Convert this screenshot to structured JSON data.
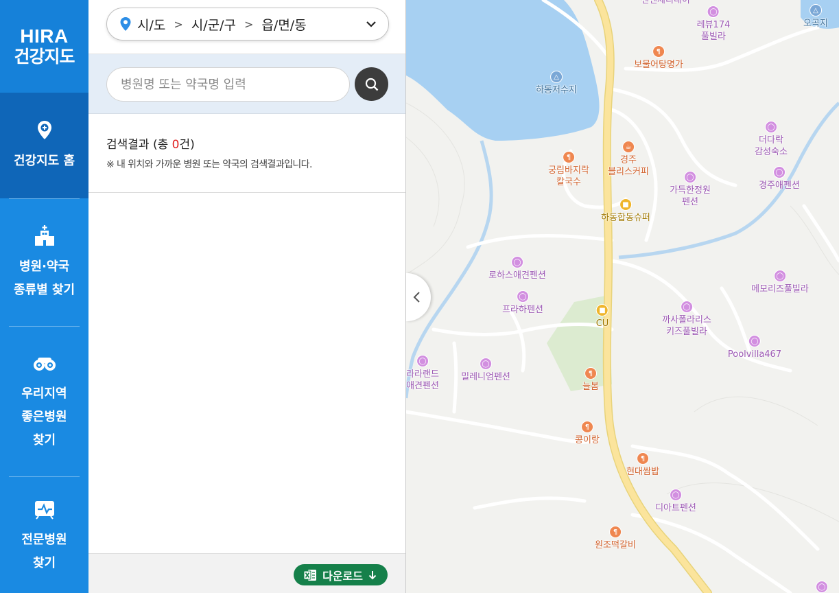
{
  "nav": {
    "logo_line1": "HIRA",
    "logo_line2": "건강지도",
    "items": [
      {
        "label": "건강지도 홈",
        "icon": "map-pin-plus-icon",
        "active": true
      },
      {
        "label_line1": "병원·약국",
        "label_line2": "종류별 찾기",
        "icon": "hospital-building-icon"
      },
      {
        "label_line1": "우리지역",
        "label_line2": "좋은병원",
        "label_line3": "찾기",
        "icon": "binoculars-icon"
      },
      {
        "label_line1": "전문병원",
        "label_line2": "찾기",
        "icon": "medical-monitor-icon"
      }
    ]
  },
  "region": {
    "level1": "시/도",
    "level2": "시/군/구",
    "level3": "읍/면/동"
  },
  "search": {
    "placeholder": "병원명 또는 약국명 입력",
    "value": ""
  },
  "results": {
    "title_prefix": "검색결과 (총 ",
    "count": "0",
    "title_suffix": "건)",
    "note": "※ 내 위치와 가까운 병원 또는 약국의 검색결과입니다."
  },
  "footer": {
    "download_label": "다운로드"
  },
  "map": {
    "pois": [
      {
        "label": "센넨체리네이",
        "type": "stay"
      },
      {
        "label": "레뷰174\n풀빌라",
        "type": "stay"
      },
      {
        "label": "오곡지",
        "type": "water"
      },
      {
        "label": "보물어탕명가",
        "type": "food"
      },
      {
        "label": "하동저수지",
        "type": "water"
      },
      {
        "label": "경주\n블리스커피",
        "type": "food"
      },
      {
        "label": "더다락\n감성숙소",
        "type": "stay"
      },
      {
        "label": "궁림바지락\n칼국수",
        "type": "food"
      },
      {
        "label": "가득한정원\n펜션",
        "type": "stay"
      },
      {
        "label": "경주애펜션",
        "type": "stay"
      },
      {
        "label": "하동합동슈퍼",
        "type": "store"
      },
      {
        "label": "로하스애견펜션",
        "type": "stay"
      },
      {
        "label": "메모리즈풀빌라",
        "type": "stay"
      },
      {
        "label": "프라하펜션",
        "type": "stay"
      },
      {
        "label": "CU",
        "type": "store"
      },
      {
        "label": "까사폴라리스\n키즈풀빌라",
        "type": "stay"
      },
      {
        "label": "Poolvilla467",
        "type": "stay"
      },
      {
        "label": "라라랜드\n애견펜션",
        "type": "stay"
      },
      {
        "label": "밀레니엄펜션",
        "type": "stay"
      },
      {
        "label": "늘봄",
        "type": "food"
      },
      {
        "label": "콩이랑",
        "type": "food"
      },
      {
        "label": "현대쌈밥",
        "type": "food"
      },
      {
        "label": "디아트펜션",
        "type": "stay"
      },
      {
        "label": "원조떡갈비",
        "type": "food"
      }
    ],
    "colors": {
      "water": "#a7d0f2",
      "road_main": "#fbe49c",
      "park": "#dcebd0",
      "road": "#ffffff"
    }
  }
}
